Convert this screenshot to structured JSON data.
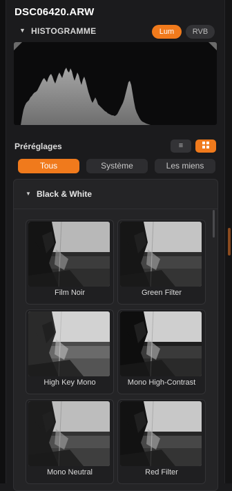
{
  "file": {
    "name": "DSC06420.ARW"
  },
  "histogram": {
    "title": "HISTOGRAMME",
    "modes": [
      "Lum",
      "RVB"
    ],
    "active_mode": "Lum",
    "fill_color": "#8c8c8c"
  },
  "presets": {
    "title": "Préréglages",
    "view_list_icon": "list-view-icon",
    "view_grid_icon": "grid-view-icon",
    "tabs": [
      "Tous",
      "Système",
      "Les miens"
    ],
    "active_tab": "Tous",
    "group": {
      "title": "Black & White",
      "items": [
        "Film Noir",
        "Green Filter",
        "High Key Mono",
        "Mono High-Contrast",
        "Mono Neutral",
        "Red Filter"
      ]
    }
  },
  "colors": {
    "accent": "#f07a1c",
    "panel": "#1b1b1d"
  }
}
